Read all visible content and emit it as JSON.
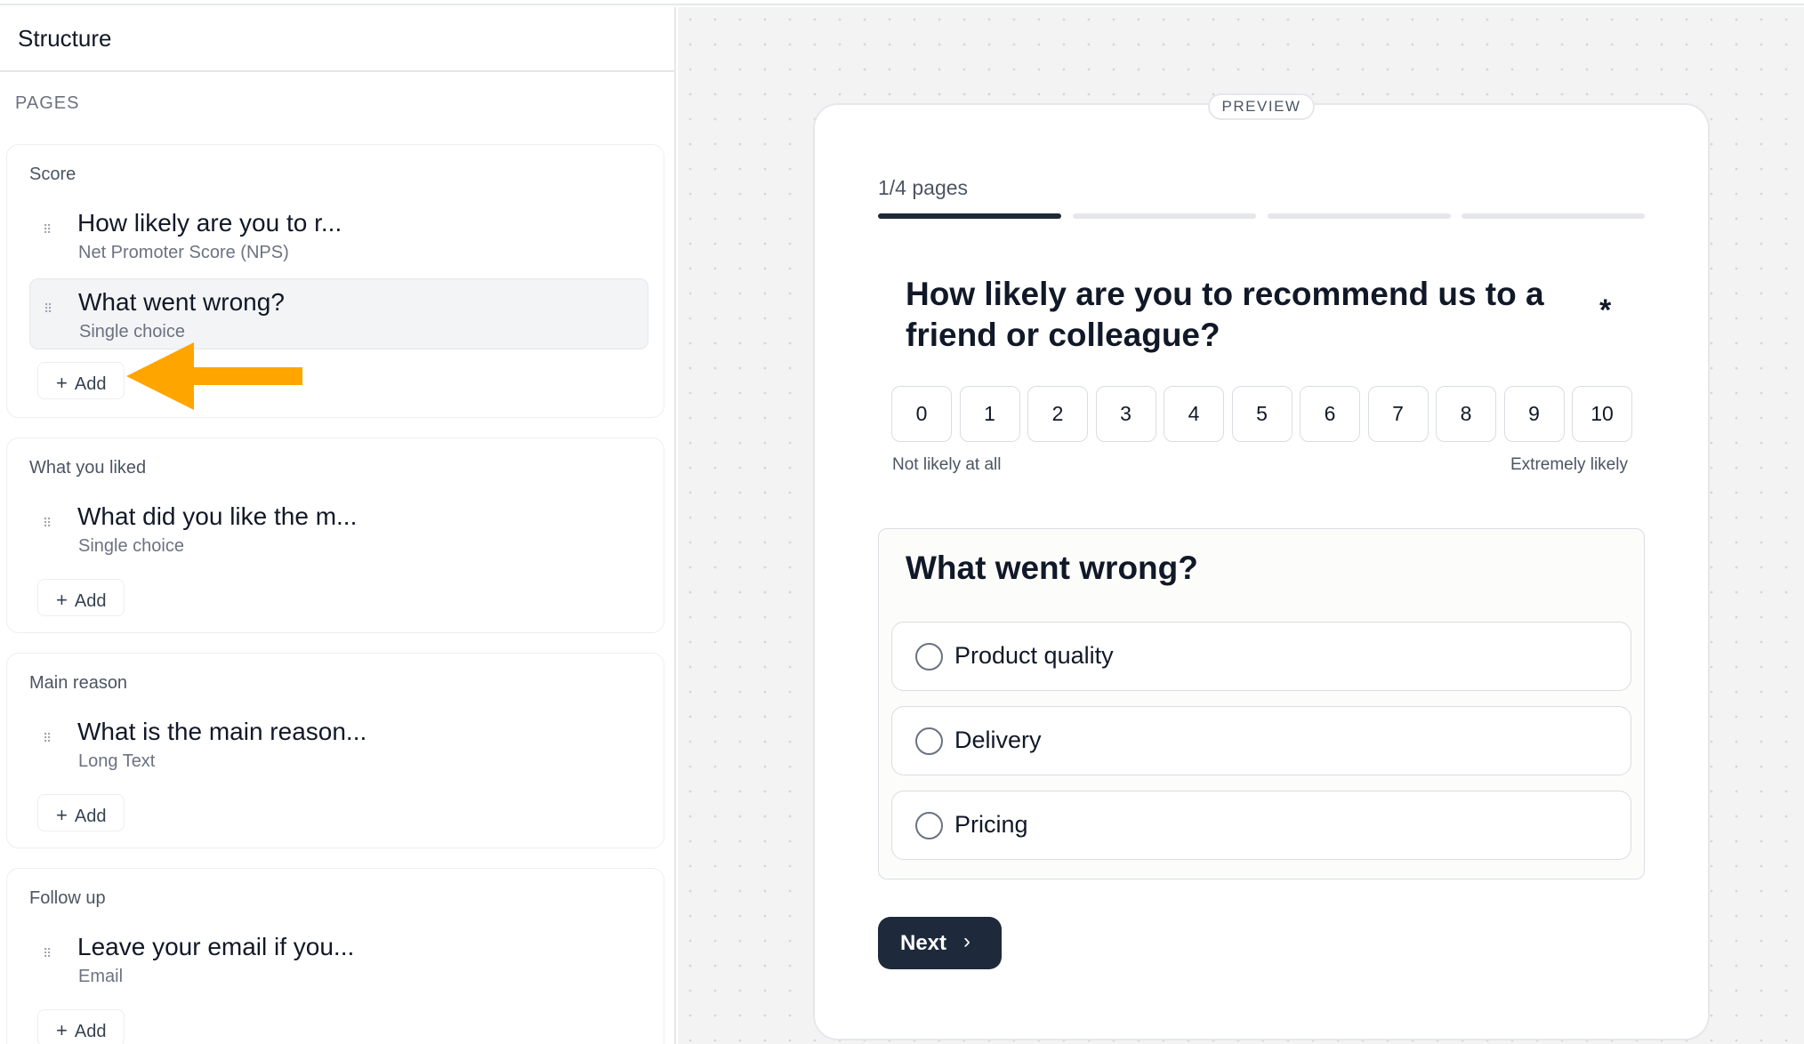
{
  "structure": {
    "title": "Structure",
    "pages_label": "PAGES",
    "add_label": "Add",
    "pages": [
      {
        "title": "Score",
        "questions": [
          {
            "title": "How likely are you to r...",
            "type": "Net Promoter Score (NPS)"
          },
          {
            "title": "What went wrong?",
            "type": "Single choice"
          }
        ]
      },
      {
        "title": "What you liked",
        "questions": [
          {
            "title": "What did you like the m...",
            "type": "Single choice"
          }
        ]
      },
      {
        "title": "Main reason",
        "questions": [
          {
            "title": "What is the main reason...",
            "type": "Long Text"
          }
        ]
      },
      {
        "title": "Follow up",
        "questions": [
          {
            "title": "Leave your email if you...",
            "type": "Email"
          }
        ]
      }
    ]
  },
  "preview": {
    "tag": "PREVIEW",
    "progress_text": "1/4 pages",
    "progress": {
      "current_page": 1,
      "total_pages": 4
    },
    "nps": {
      "question": "How likely are you to recommend us to a friend or colleague?",
      "required_mark": "*",
      "scale": [
        "0",
        "1",
        "2",
        "3",
        "4",
        "5",
        "6",
        "7",
        "8",
        "9",
        "10"
      ],
      "low_label": "Not likely at all",
      "high_label": "Extremely likely"
    },
    "choice": {
      "question": "What went wrong?",
      "options": [
        "Product quality",
        "Delivery",
        "Pricing"
      ]
    },
    "next_label": "Next"
  },
  "colors": {
    "arrow": "#FFA500",
    "primary_button": "#1E2A3B",
    "progress_active": "#1F2937"
  }
}
